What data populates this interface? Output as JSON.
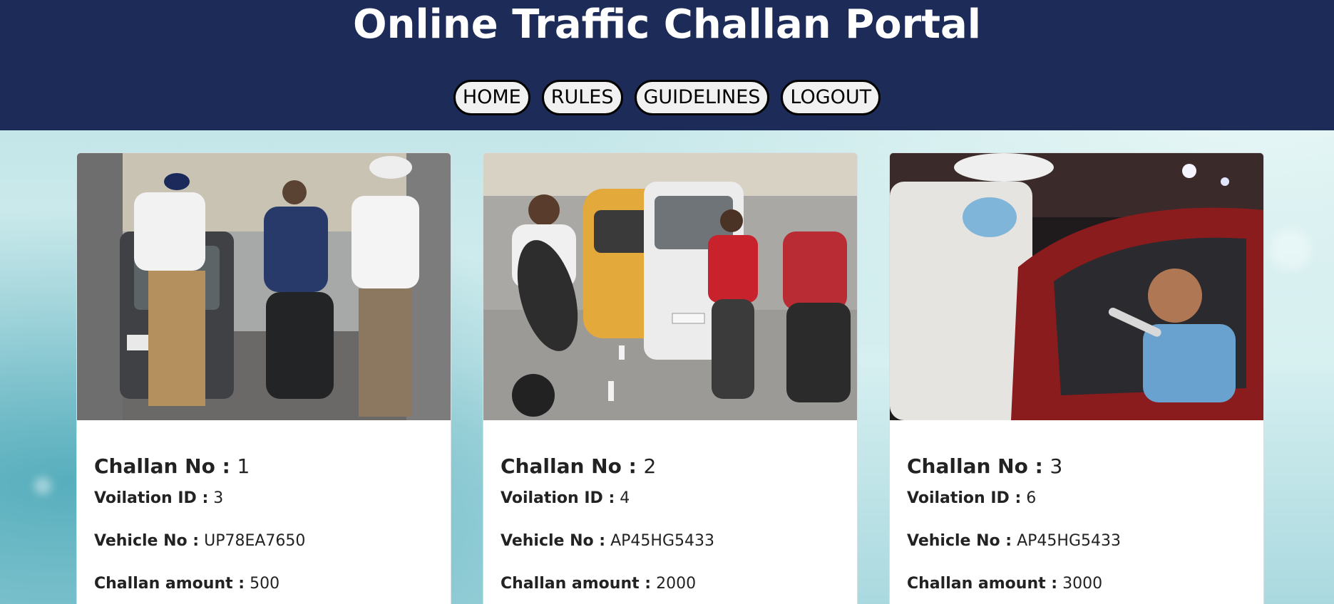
{
  "header": {
    "title": "Online Traffic Challan Portal",
    "nav": [
      "HOME",
      "RULES",
      "GUIDELINES",
      "LOGOUT"
    ]
  },
  "labels": {
    "challan_no": "Challan No :",
    "violation_id": "Voilation ID :",
    "vehicle_no": "Vehicle No :",
    "challan_amount": "Challan amount :"
  },
  "cards": [
    {
      "challan_no": "1",
      "violation_id": "3",
      "vehicle_no": "UP78EA7650",
      "challan_amount": "500",
      "photo": "police checking car with motorcyclists"
    },
    {
      "challan_no": "2",
      "violation_id": "4",
      "vehicle_no": "AP45HG5433",
      "challan_amount": "2000",
      "photo": "motorcyclist wheelie in traffic"
    },
    {
      "challan_no": "3",
      "violation_id": "6",
      "vehicle_no": "AP45HG5433",
      "challan_amount": "3000",
      "photo": "police breathalyzer test on driver"
    }
  ],
  "colors": {
    "header_bg": "#1c2b58",
    "nav_bg": "#f1f1f1",
    "card_bg": "#ffffff"
  }
}
